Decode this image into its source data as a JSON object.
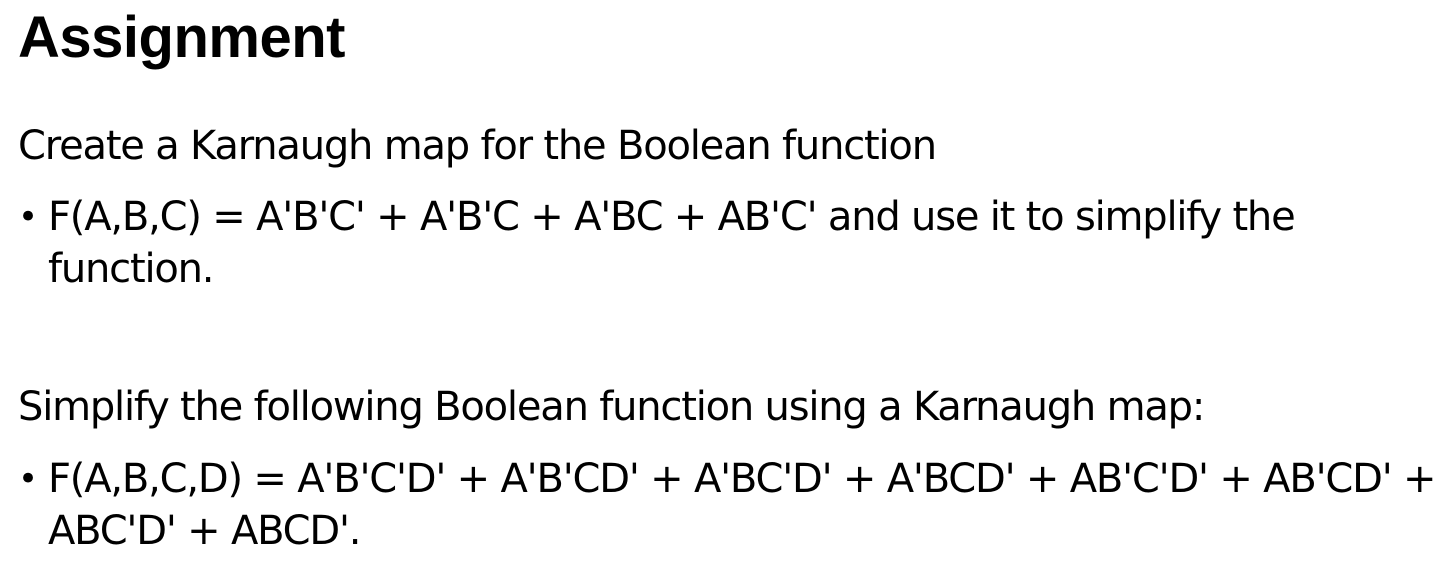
{
  "slide": {
    "title": "Assignment",
    "sections": [
      {
        "intro": "Create a Karnaugh map for the Boolean function",
        "bullet_symbol": "•",
        "bullet_lines": [
          "F(A,B,C) = A'B'C' + A'B'C + A'BC + AB'C' and use it to simplify the",
          "function."
        ]
      },
      {
        "intro": "Simplify the following Boolean function using a Karnaugh map:",
        "bullet_symbol": "•",
        "bullet_lines": [
          "F(A,B,C,D) = A'B'C'D' + A'B'CD' + A'BC'D' + A'BCD' + AB'C'D' + AB'CD' +",
          "ABC'D' + ABCD'."
        ]
      }
    ]
  }
}
